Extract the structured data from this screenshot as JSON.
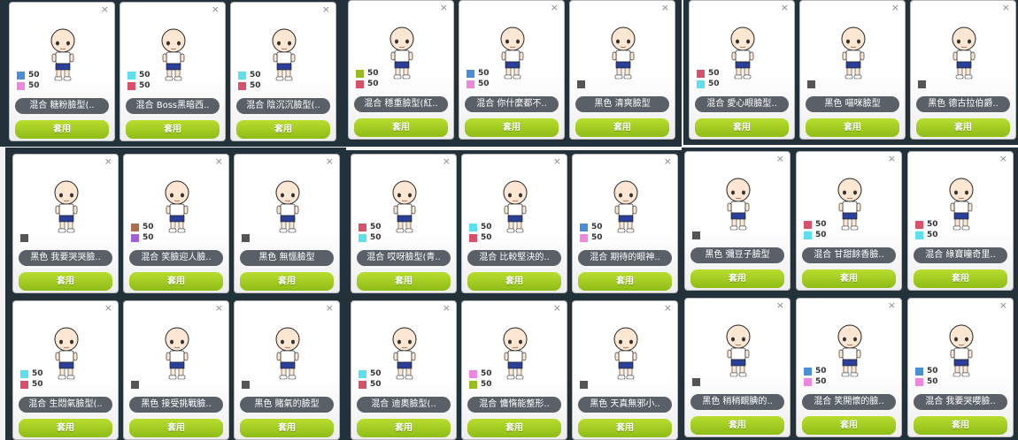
{
  "apply_label": "套用",
  "close_label": "×",
  "colors": {
    "blue": "#4a8fd6",
    "pink": "#ee88dd",
    "cyan": "#5ce0f0",
    "red": "#d8506a",
    "olive": "#99bb22",
    "brown": "#a87050",
    "purple": "#a060d8",
    "black": "#555555"
  },
  "cards": [
    {
      "name": "混合 糖粉臉型(..",
      "swatches": [
        {
          "color": "blue",
          "value": "50"
        },
        {
          "color": "pink",
          "value": "50"
        }
      ]
    },
    {
      "name": "混合 Boss黑暗西..",
      "swatches": [
        {
          "color": "cyan",
          "value": "50"
        },
        {
          "color": "red",
          "value": "50"
        }
      ]
    },
    {
      "name": "混合 陰沉沉臉型(..",
      "swatches": [
        {
          "color": "cyan",
          "value": "50"
        },
        {
          "color": "red",
          "value": "50"
        }
      ]
    },
    {
      "name": "混合 穩重臉型(紅..",
      "swatches": [
        {
          "color": "olive",
          "value": "50"
        },
        {
          "color": "red",
          "value": "50"
        }
      ]
    },
    {
      "name": "混合 你什麼都不..",
      "swatches": [
        {
          "color": "blue",
          "value": "50"
        },
        {
          "color": "pink",
          "value": "50"
        }
      ]
    },
    {
      "name": "黑色 清爽臉型",
      "swatches": [
        {
          "color": "black",
          "value": ""
        }
      ]
    },
    {
      "name": "混合 愛心眼臉型..",
      "swatches": [
        {
          "color": "red",
          "value": "50"
        },
        {
          "color": "cyan",
          "value": "50"
        }
      ]
    },
    {
      "name": "黑色 喵咪臉型",
      "swatches": [
        {
          "color": "black",
          "value": ""
        }
      ]
    },
    {
      "name": "黑色 德古拉伯爵..",
      "swatches": [
        {
          "color": "black",
          "value": ""
        }
      ]
    },
    {
      "name": "黑色 我要哭哭臉..",
      "swatches": [
        {
          "color": "black",
          "value": ""
        }
      ]
    },
    {
      "name": "混合 笑臉迎人臉..",
      "swatches": [
        {
          "color": "brown",
          "value": "50"
        },
        {
          "color": "purple",
          "value": "50"
        }
      ]
    },
    {
      "name": "黑色 無慍臉型",
      "swatches": [
        {
          "color": "black",
          "value": ""
        }
      ]
    },
    {
      "name": "混合 哎呀臉型(青..",
      "swatches": [
        {
          "color": "red",
          "value": "50"
        },
        {
          "color": "cyan",
          "value": "50"
        }
      ]
    },
    {
      "name": "混合 比較堅決的..",
      "swatches": [
        {
          "color": "cyan",
          "value": "50"
        },
        {
          "color": "red",
          "value": "50"
        }
      ]
    },
    {
      "name": "混合 期待的眼神..",
      "swatches": [
        {
          "color": "blue",
          "value": "50"
        },
        {
          "color": "pink",
          "value": "50"
        }
      ]
    },
    {
      "name": "黑色 彌豆子臉型",
      "swatches": [
        {
          "color": "black",
          "value": ""
        }
      ]
    },
    {
      "name": "混合 甘甜餘香臉..",
      "swatches": [
        {
          "color": "red",
          "value": "50"
        },
        {
          "color": "cyan",
          "value": "50"
        }
      ]
    },
    {
      "name": "混合 綠寶瞳奇里..",
      "swatches": [
        {
          "color": "red",
          "value": "50"
        },
        {
          "color": "cyan",
          "value": "50"
        }
      ]
    },
    {
      "name": "混合 生悶氣臉型(..",
      "swatches": [
        {
          "color": "cyan",
          "value": "50"
        },
        {
          "color": "red",
          "value": "50"
        }
      ]
    },
    {
      "name": "黑色 接受挑戰臉..",
      "swatches": [
        {
          "color": "black",
          "value": ""
        }
      ]
    },
    {
      "name": "黑色 賭氣的臉型",
      "swatches": [
        {
          "color": "black",
          "value": ""
        }
      ]
    },
    {
      "name": "混合 迪奧臉型(..",
      "swatches": [
        {
          "color": "cyan",
          "value": "50"
        },
        {
          "color": "red",
          "value": "50"
        }
      ]
    },
    {
      "name": "混合 慵惰能整形..",
      "swatches": [
        {
          "color": "pink",
          "value": "50"
        },
        {
          "color": "olive",
          "value": "50"
        }
      ]
    },
    {
      "name": "黑色 天真無邪小..",
      "swatches": [
        {
          "color": "black",
          "value": ""
        }
      ]
    },
    {
      "name": "黑色 稍稍靦腆的..",
      "swatches": [
        {
          "color": "black",
          "value": ""
        }
      ]
    },
    {
      "name": "混合 笑開懷的臉..",
      "swatches": [
        {
          "color": "blue",
          "value": "50"
        },
        {
          "color": "pink",
          "value": "50"
        }
      ]
    },
    {
      "name": "混合 我要哭嚶臉..",
      "swatches": [
        {
          "color": "blue",
          "value": "50"
        },
        {
          "color": "pink",
          "value": "50"
        }
      ]
    }
  ]
}
